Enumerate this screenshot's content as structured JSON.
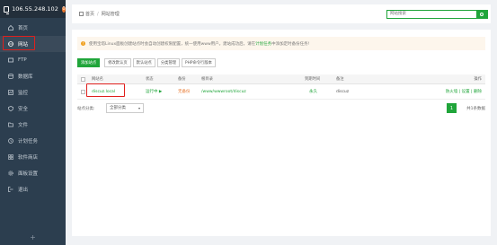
{
  "sidebar": {
    "ip": "106.55.248.102",
    "badge": "0",
    "items": [
      {
        "label": "首页",
        "icon": "home-icon"
      },
      {
        "label": "网站",
        "icon": "globe-icon"
      },
      {
        "label": "FTP",
        "icon": "ftp-icon"
      },
      {
        "label": "数据库",
        "icon": "database-icon"
      },
      {
        "label": "监控",
        "icon": "monitor-icon"
      },
      {
        "label": "安全",
        "icon": "shield-icon"
      },
      {
        "label": "文件",
        "icon": "folder-icon"
      },
      {
        "label": "计划任务",
        "icon": "clock-icon"
      },
      {
        "label": "软件商店",
        "icon": "store-icon"
      },
      {
        "label": "面板设置",
        "icon": "gear-icon"
      },
      {
        "label": "退出",
        "icon": "logout-icon"
      }
    ],
    "add": "+"
  },
  "breadcrumb": {
    "home": "首页",
    "sep": "/",
    "current": "网站管理"
  },
  "search": {
    "placeholder": "网站搜索"
  },
  "notice": {
    "text": "使用宝塔Linux面板创建站点时会自动创建权限配置，统一使用www用户。建站成功后，请在",
    "link": "计划任务",
    "tail": "中添加定时备份任务!"
  },
  "toolbar": {
    "add": "添加站点",
    "default_page": "修改默认页",
    "default_site": "默认站点",
    "category": "分类管理",
    "php_cli": "PHP命令行版本"
  },
  "table": {
    "headers": {
      "name": "网站名",
      "status": "状态",
      "backup": "备份",
      "root": "根目录",
      "expire": "到期时间",
      "note": "备注",
      "action": "操作"
    },
    "rows": [
      {
        "name": "discuz.local",
        "status": "运行中 ▶",
        "backup": "无备份",
        "root": "/www/wwwroot/discuz",
        "expire": "永久",
        "note": "discuz",
        "actions": "防火墙 | 设置 | 删除"
      }
    ]
  },
  "footer": {
    "category_label": "站点分类:",
    "category_value": "全部分类",
    "page": "1",
    "total": "共1条数据"
  },
  "colors": {
    "accent": "#20a53a",
    "sidebar": "#2c3e4f",
    "highlight": "#e0201d"
  }
}
